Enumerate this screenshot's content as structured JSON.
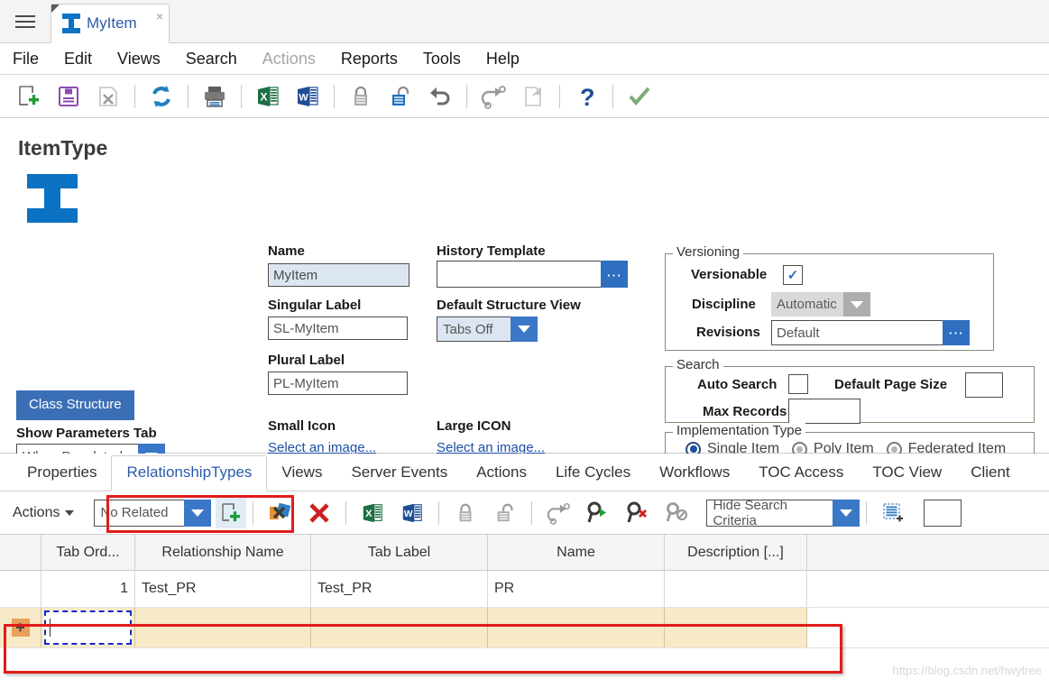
{
  "titlebar": {
    "menu_icon": "hamburger-icon",
    "tab": {
      "label": "MyItem",
      "close": "×",
      "icon": "itemtype-ibeam-icon"
    }
  },
  "menubar": {
    "items": [
      {
        "label": "File",
        "disabled": false
      },
      {
        "label": "Edit",
        "disabled": false
      },
      {
        "label": "Views",
        "disabled": false
      },
      {
        "label": "Search",
        "disabled": false
      },
      {
        "label": "Actions",
        "disabled": true
      },
      {
        "label": "Reports",
        "disabled": false
      },
      {
        "label": "Tools",
        "disabled": false
      },
      {
        "label": "Help",
        "disabled": false
      }
    ]
  },
  "toolbar": {
    "buttons": [
      {
        "name": "new-icon",
        "title": "New"
      },
      {
        "name": "save-icon",
        "title": "Save"
      },
      {
        "name": "delete-icon",
        "title": "Delete"
      },
      {
        "name": "refresh-icon",
        "title": "Refresh"
      },
      {
        "name": "print-icon",
        "title": "Print"
      },
      {
        "name": "export-excel-icon",
        "title": "Export to Excel"
      },
      {
        "name": "export-word-icon",
        "title": "Export to Word"
      },
      {
        "name": "lock-icon",
        "title": "Lock"
      },
      {
        "name": "unlock-icon",
        "title": "Unlock"
      },
      {
        "name": "undo-icon",
        "title": "Undo"
      },
      {
        "name": "redo-version-icon",
        "title": "New Version"
      },
      {
        "name": "copy-icon",
        "title": "Copy"
      },
      {
        "name": "help-icon",
        "title": "Help"
      },
      {
        "name": "done-check-icon",
        "title": "Done"
      }
    ]
  },
  "form": {
    "title": "ItemType",
    "class_structure_button": "Class Structure",
    "show_parameters_tab_label": "Show Parameters Tab",
    "show_parameters_tab_value": "When Populated",
    "name_label": "Name",
    "name_value": "MyItem",
    "singular_label_label": "Singular Label",
    "singular_label_value": "SL-MyItem",
    "plural_label_label": "Plural Label",
    "plural_label_value": "PL-MyItem",
    "history_template_label": "History Template",
    "history_template_value": "",
    "default_structure_view_label": "Default Structure View",
    "default_structure_view_value": "Tabs Off",
    "small_icon_label": "Small Icon",
    "small_icon_link": "Select an image...",
    "large_icon_label": "Large ICON",
    "large_icon_link": "Select an image...",
    "versioning": {
      "legend": "Versioning",
      "versionable_label": "Versionable",
      "versionable_checked": true,
      "versionable_mark": "✓",
      "discipline_label": "Discipline",
      "discipline_value": "Automatic",
      "revisions_label": "Revisions",
      "revisions_value": "Default"
    },
    "search": {
      "legend": "Search",
      "auto_search_label": "Auto Search",
      "auto_search_checked": false,
      "default_page_size_label": "Default Page Size",
      "default_page_size_value": "",
      "max_records_label": "Max Records",
      "max_records_value": ""
    },
    "implementation": {
      "legend": "Implementation Type",
      "options": [
        {
          "label": "Single Item",
          "selected": true
        },
        {
          "label": "Poly Item",
          "selected": false
        },
        {
          "label": "Federated Item",
          "selected": false
        }
      ]
    }
  },
  "bottom_tabs": [
    {
      "label": "Properties",
      "active": false
    },
    {
      "label": "RelationshipTypes",
      "active": true
    },
    {
      "label": "Views",
      "active": false
    },
    {
      "label": "Server Events",
      "active": false
    },
    {
      "label": "Actions",
      "active": false
    },
    {
      "label": "Life Cycles",
      "active": false
    },
    {
      "label": "Workflows",
      "active": false
    },
    {
      "label": "TOC Access",
      "active": false
    },
    {
      "label": "TOC View",
      "active": false
    },
    {
      "label": "Client",
      "active": false
    }
  ],
  "grid_toolbar": {
    "actions_label": "Actions",
    "relationship_filter_value": "No Related",
    "search_criteria_value": "Hide Search Criteria",
    "buttons": [
      {
        "name": "add-related-icon"
      },
      {
        "name": "relationship-map-icon"
      },
      {
        "name": "remove-red-x-icon"
      },
      {
        "name": "export-excel-icon"
      },
      {
        "name": "export-word-icon"
      },
      {
        "name": "lock-icon"
      },
      {
        "name": "unlock-icon"
      },
      {
        "name": "new-version-icon"
      },
      {
        "name": "run-search-icon"
      },
      {
        "name": "clear-search-icon"
      },
      {
        "name": "disabled-search-icon"
      },
      {
        "name": "insert-row-icon"
      }
    ]
  },
  "grid": {
    "columns": [
      "Tab Ord...",
      "Relationship Name",
      "Tab Label",
      "Name",
      "Description [...]"
    ],
    "rows": [
      {
        "cells": [
          "1",
          "Test_PR",
          "Test_PR",
          "PR",
          ""
        ],
        "new": false
      },
      {
        "cells": [
          "",
          "",
          "",
          "",
          ""
        ],
        "new": true
      }
    ]
  },
  "watermark": "https://blog.csdn.net/hwytree"
}
